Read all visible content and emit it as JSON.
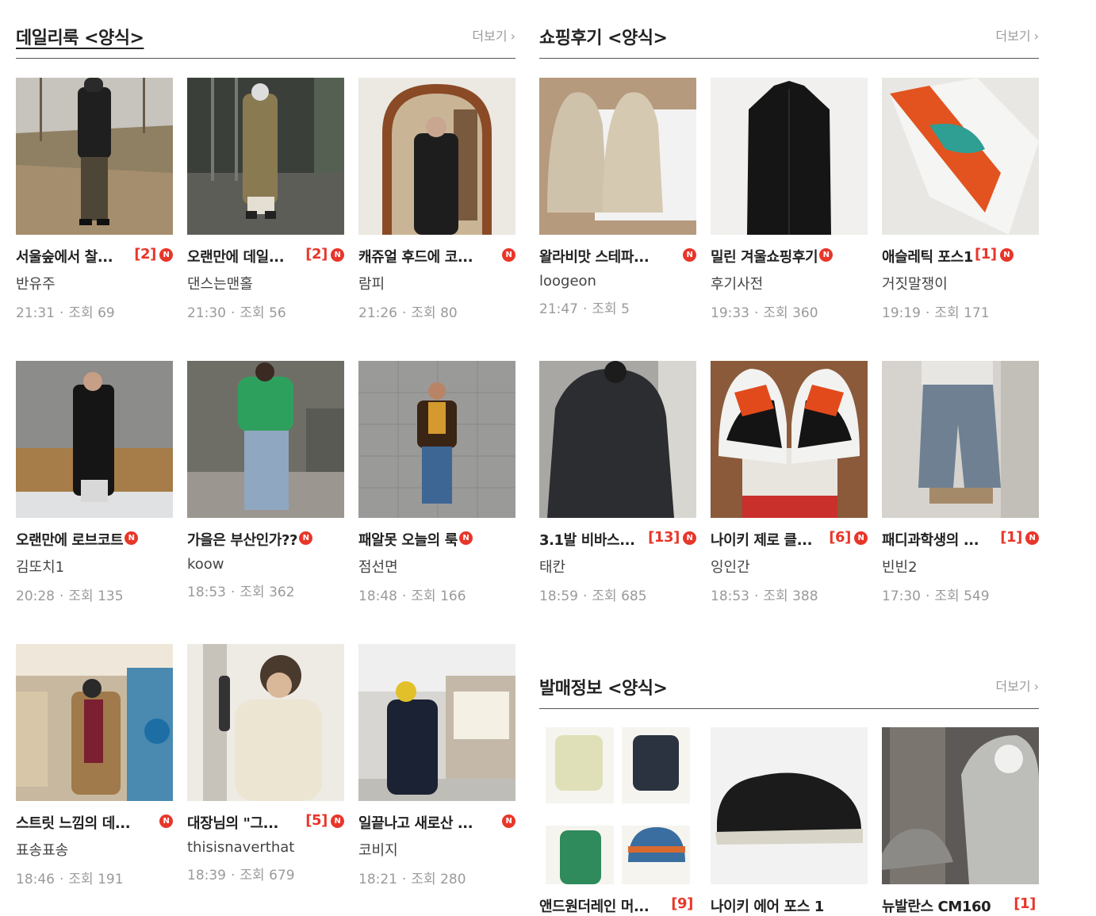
{
  "sections": {
    "daily": {
      "title": "데일리룩 <양식>",
      "more": "더보기",
      "cards": [
        {
          "title": "서울숲에서 찰...",
          "comments": "[2]",
          "new": "N",
          "author": "반유주",
          "time": "21:31",
          "views_label": "조회",
          "views": "69"
        },
        {
          "title": "오랜만에 데일...",
          "comments": "[2]",
          "new": "N",
          "author": "댄스는맨홀",
          "time": "21:30",
          "views_label": "조회",
          "views": "56"
        },
        {
          "title": "캐쥬얼 후드에 코...",
          "comments": "",
          "new": "N",
          "author": "람피",
          "time": "21:26",
          "views_label": "조회",
          "views": "80"
        },
        {
          "title": "오랜만에 로브코트",
          "comments": "",
          "new": "N",
          "author": "김또치1",
          "time": "20:28",
          "views_label": "조회",
          "views": "135"
        },
        {
          "title": "가을은 부산인가??",
          "comments": "",
          "new": "N",
          "author": "koow",
          "time": "18:53",
          "views_label": "조회",
          "views": "362"
        },
        {
          "title": "패알못 오늘의 룩",
          "comments": "",
          "new": "N",
          "author": "점선면",
          "time": "18:48",
          "views_label": "조회",
          "views": "166"
        },
        {
          "title": "스트릿 느낌의 데...",
          "comments": "",
          "new": "N",
          "author": "표송표송",
          "time": "18:46",
          "views_label": "조회",
          "views": "191"
        },
        {
          "title": "대장님의 \"그...",
          "comments": "[5]",
          "new": "N",
          "author": "thisisnaverthat",
          "time": "18:39",
          "views_label": "조회",
          "views": "679"
        },
        {
          "title": "일끝나고 새로산 ...",
          "comments": "",
          "new": "N",
          "author": "코비지",
          "time": "18:21",
          "views_label": "조회",
          "views": "280"
        }
      ]
    },
    "review": {
      "title": "쇼핑후기 <양식>",
      "more": "더보기",
      "cards": [
        {
          "title": "왈라비맛 스테파...",
          "comments": "",
          "new": "N",
          "author": "loogeon",
          "time": "21:47",
          "views_label": "조회",
          "views": "5"
        },
        {
          "title": "밀린 겨울쇼핑후기",
          "comments": "",
          "new": "N",
          "author": "후기사전",
          "time": "19:33",
          "views_label": "조회",
          "views": "360"
        },
        {
          "title": "애슬레틱 포스1",
          "comments": "[1]",
          "new": "N",
          "author": "거짓말쟁이",
          "time": "19:19",
          "views_label": "조회",
          "views": "171"
        },
        {
          "title": "3.1발 비바스...",
          "comments": "[13]",
          "new": "N",
          "author": "태칸",
          "time": "18:59",
          "views_label": "조회",
          "views": "685"
        },
        {
          "title": "나이키 제로 클...",
          "comments": "[6]",
          "new": "N",
          "author": "잉인간",
          "time": "18:53",
          "views_label": "조회",
          "views": "388"
        },
        {
          "title": "패디과학생의 ...",
          "comments": "[1]",
          "new": "N",
          "author": "빈빈2",
          "time": "17:30",
          "views_label": "조회",
          "views": "549"
        }
      ]
    },
    "release": {
      "title": "발매정보 <양식>",
      "more": "더보기",
      "cards": [
        {
          "title": "앤드원더레인 머...",
          "comments": "[9]",
          "new": "",
          "author": "",
          "time": "",
          "views_label": "",
          "views": ""
        },
        {
          "title": "나이키 에어 포스 1",
          "comments": "",
          "new": "",
          "author": "",
          "time": "",
          "views_label": "",
          "views": ""
        },
        {
          "title": "뉴발란스 CM160",
          "comments": "[1]",
          "new": "",
          "author": "",
          "time": "",
          "views_label": "",
          "views": ""
        }
      ]
    }
  },
  "icons": {
    "more": "chevron-right-icon",
    "new": "new-badge-icon"
  },
  "colors": {
    "accent": "#e8362a",
    "muted": "#9a9a9a",
    "divider": "#555555"
  }
}
